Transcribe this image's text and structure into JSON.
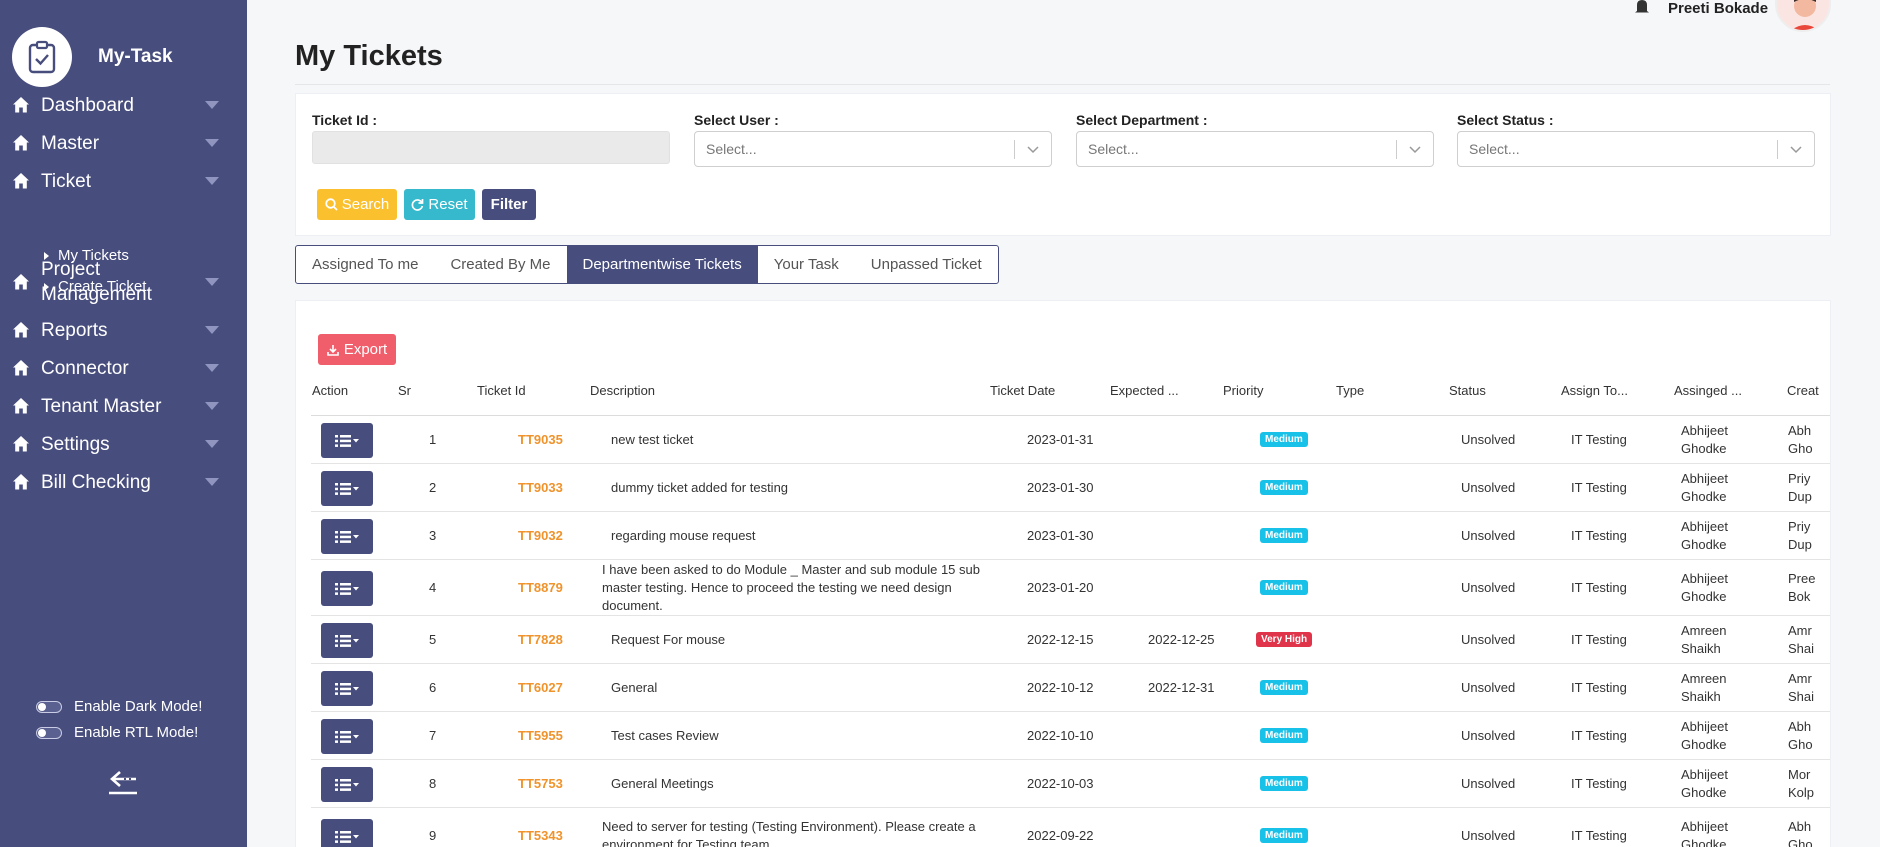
{
  "app": {
    "name": "My-Task"
  },
  "sidebar": {
    "items": [
      {
        "label": "Dashboard"
      },
      {
        "label": "Master"
      },
      {
        "label": "Ticket"
      },
      {
        "label": "Project Management"
      },
      {
        "label": "Reports"
      },
      {
        "label": "Connector"
      },
      {
        "label": "Tenant Master"
      },
      {
        "label": "Settings"
      },
      {
        "label": "Bill Checking"
      }
    ],
    "ticket_sub": [
      "My Tickets",
      "Create Ticket"
    ],
    "dark_mode_label": "Enable Dark Mode!",
    "rtl_mode_label": "Enable RTL Mode!"
  },
  "header": {
    "user_name": "Preeti Bokade"
  },
  "page": {
    "title": "My Tickets"
  },
  "filters": {
    "ticket_id_label": "Ticket Id :",
    "user_label": "Select User :",
    "department_label": "Select Department :",
    "status_label": "Select Status :",
    "select_placeholder": "Select...",
    "search_label": "Search",
    "reset_label": "Reset",
    "filter_label": "Filter"
  },
  "tabs": [
    "Assigned To me",
    "Created By Me",
    "Departmentwise Tickets",
    "Your Task",
    "Unpassed Ticket"
  ],
  "active_tab": "Departmentwise Tickets",
  "table": {
    "export_label": "Export",
    "columns": [
      "Action",
      "Sr",
      "Ticket Id",
      "Description",
      "Ticket Date",
      "Expected ...",
      "Priority",
      "Type",
      "Status",
      "Assign To...",
      "Assinged ...",
      "Creat"
    ],
    "rows": [
      {
        "sr": "1",
        "ticket_id": "TT9035",
        "description": "new test ticket",
        "ticket_date": "2023-01-31",
        "expected": "",
        "priority": "Medium",
        "status": "Unsolved",
        "assign_to": "IT Testing",
        "assigned_by": "Abhijeet Ghodke",
        "created_by": "Abh Gho"
      },
      {
        "sr": "2",
        "ticket_id": "TT9033",
        "description": "dummy ticket added for testing",
        "ticket_date": "2023-01-30",
        "expected": "",
        "priority": "Medium",
        "status": "Unsolved",
        "assign_to": "IT Testing",
        "assigned_by": "Abhijeet Ghodke",
        "created_by": "Priy Dup"
      },
      {
        "sr": "3",
        "ticket_id": "TT9032",
        "description": "regarding mouse request",
        "ticket_date": "2023-01-30",
        "expected": "",
        "priority": "Medium",
        "status": "Unsolved",
        "assign_to": "IT Testing",
        "assigned_by": "Abhijeet Ghodke",
        "created_by": "Priy Dup"
      },
      {
        "sr": "4",
        "ticket_id": "TT8879",
        "description": "I have been asked to do Module _ Master and sub module 15 sub master testing. Hence to proceed the testing we need design document.",
        "ticket_date": "2023-01-20",
        "expected": "",
        "priority": "Medium",
        "status": "Unsolved",
        "assign_to": "IT Testing",
        "assigned_by": "Abhijeet Ghodke",
        "created_by": "Pree Bok"
      },
      {
        "sr": "5",
        "ticket_id": "TT7828",
        "description": "Request For mouse",
        "ticket_date": "2022-12-15",
        "expected": "2022-12-25",
        "priority": "Very High",
        "status": "Unsolved",
        "assign_to": "IT Testing",
        "assigned_by": "Amreen Shaikh",
        "created_by": "Amr Shai"
      },
      {
        "sr": "6",
        "ticket_id": "TT6027",
        "description": "General",
        "ticket_date": "2022-10-12",
        "expected": "2022-12-31",
        "priority": "Medium",
        "status": "Unsolved",
        "assign_to": "IT Testing",
        "assigned_by": "Amreen Shaikh",
        "created_by": "Amr Shai"
      },
      {
        "sr": "7",
        "ticket_id": "TT5955",
        "description": "Test cases Review",
        "ticket_date": "2022-10-10",
        "expected": "",
        "priority": "Medium",
        "status": "Unsolved",
        "assign_to": "IT Testing",
        "assigned_by": "Abhijeet Ghodke",
        "created_by": "Abh Gho"
      },
      {
        "sr": "8",
        "ticket_id": "TT5753",
        "description": "General Meetings",
        "ticket_date": "2022-10-03",
        "expected": "",
        "priority": "Medium",
        "status": "Unsolved",
        "assign_to": "IT Testing",
        "assigned_by": "Abhijeet Ghodke",
        "created_by": "Mor Kolp"
      },
      {
        "sr": "9",
        "ticket_id": "TT5343",
        "description": "Need to server for testing (Testing Environment). Please create a environment for Testing team",
        "ticket_date": "2022-09-22",
        "expected": "",
        "priority": "Medium",
        "status": "Unsolved",
        "assign_to": "IT Testing",
        "assigned_by": "Abhijeet Ghodke",
        "created_by": "Abh Gho"
      }
    ]
  },
  "colors": {
    "sidebar": "#474d7c",
    "medium": "#17c1e8",
    "very_high": "#e0344a",
    "ticket_id": "#f0932b",
    "search": "#fbc02d",
    "reset": "#36b9cc",
    "export": "#f05d6b"
  }
}
